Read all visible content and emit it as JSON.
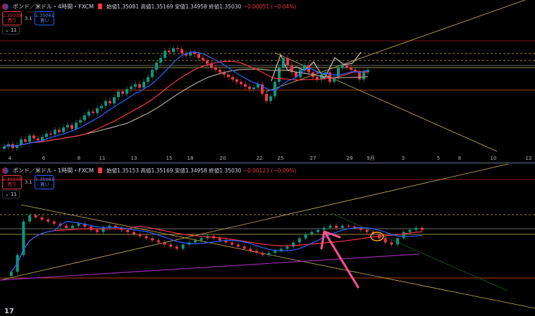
{
  "top": {
    "symbol": "ポンド／米ドル・4時間・FXCM",
    "ohlc": {
      "open_label": "始値",
      "open": "1.35081",
      "high_label": "高値",
      "high": "1.35169",
      "low_label": "安値",
      "low": "1.34958",
      "close_label": "終値",
      "close": "1.35030",
      "change": "−0.00051 (−0.04%)"
    },
    "sell_price": "1.35039",
    "sell_label": "売り",
    "spread": "3.1",
    "buy_price": "1.35061",
    "buy_label": "買い",
    "indicator_count": "11"
  },
  "bottom": {
    "symbol": "ポンド／米ドル・1時間・FXCM",
    "ohlc": {
      "open_label": "始値",
      "open": "1.35153",
      "high_label": "高値",
      "high": "1.35169",
      "low_label": "安値",
      "low": "1.34958",
      "close_label": "終値",
      "close": "1.35030",
      "change": "−0.00123 (−0.09%)"
    },
    "sell_price": "1.35039",
    "sell_label": "売り",
    "spread": "3.1",
    "buy_price": "1.35061",
    "buy_label": "買い",
    "indicator_count": "11"
  },
  "chart_data": [
    {
      "type": "candlestick",
      "timeframe": "4時間",
      "x_ticks": [
        "4",
        "6",
        "8",
        "11",
        "13",
        "15",
        "18",
        "20",
        "22",
        "25",
        "27",
        "29",
        "9月",
        "3",
        "5",
        "8",
        "10",
        "12"
      ],
      "closes": [
        1.3375,
        1.338,
        1.3372,
        1.3378,
        1.339,
        1.3385,
        1.3398,
        1.3392,
        1.3388,
        1.3395,
        1.3402,
        1.34,
        1.341,
        1.3405,
        1.3415,
        1.342,
        1.3412,
        1.3425,
        1.343,
        1.344,
        1.3448,
        1.3445,
        1.3455,
        1.346,
        1.347,
        1.3465,
        1.3478,
        1.349,
        1.3485,
        1.3495,
        1.35,
        1.3505,
        1.3498,
        1.351,
        1.352,
        1.3535,
        1.355,
        1.356,
        1.3575,
        1.3572,
        1.358,
        1.3578,
        1.357,
        1.3565,
        1.3572,
        1.3568,
        1.356,
        1.3555,
        1.3548,
        1.354,
        1.3535,
        1.353,
        1.3525,
        1.352,
        1.3515,
        1.351,
        1.3505,
        1.35,
        1.3495,
        1.3498,
        1.3505,
        1.3485,
        1.347,
        1.348,
        1.351,
        1.354,
        1.356,
        1.3545,
        1.353,
        1.352,
        1.3535,
        1.3545,
        1.353,
        1.352,
        1.3515,
        1.3525,
        1.353,
        1.351,
        1.352,
        1.354,
        1.3545,
        1.354,
        1.3535,
        1.353,
        1.3515,
        1.353,
        1.3535
      ],
      "colors": {
        "up": "#089981",
        "down": "#f23645",
        "ma_fast": "#2962ff",
        "ma_slow": "#f23645",
        "ma_long": "#b2a79a",
        "trendline": "#c9b458"
      }
    },
    {
      "type": "candlestick",
      "timeframe": "1時間",
      "closes": [
        1.344,
        1.348,
        1.356,
        1.3575,
        1.357,
        1.3565,
        1.356,
        1.3555,
        1.355,
        1.3545,
        1.355,
        1.3555,
        1.3548,
        1.354,
        1.3535,
        1.3545,
        1.355,
        1.3545,
        1.354,
        1.3535,
        1.353,
        1.3525,
        1.352,
        1.3515,
        1.351,
        1.3505,
        1.35,
        1.3495,
        1.3505,
        1.351,
        1.3515,
        1.352,
        1.3525,
        1.352,
        1.3515,
        1.351,
        1.3505,
        1.35,
        1.3495,
        1.349,
        1.3485,
        1.348,
        1.3485,
        1.349,
        1.3495,
        1.35,
        1.351,
        1.352,
        1.353,
        1.3535,
        1.354,
        1.3545,
        1.355,
        1.3545,
        1.355,
        1.3548,
        1.3545,
        1.354,
        1.3535,
        1.353,
        1.352,
        1.351,
        1.3505,
        1.352,
        1.3535,
        1.354,
        1.3545,
        1.354
      ],
      "colors": {
        "up": "#089981",
        "down": "#f23645",
        "ma_fast": "#2962ff",
        "ma_slow": "#f23645",
        "ma_long": "#9c27b0",
        "trendline": "#c9b458",
        "arrow": "#ff4f93"
      }
    }
  ]
}
